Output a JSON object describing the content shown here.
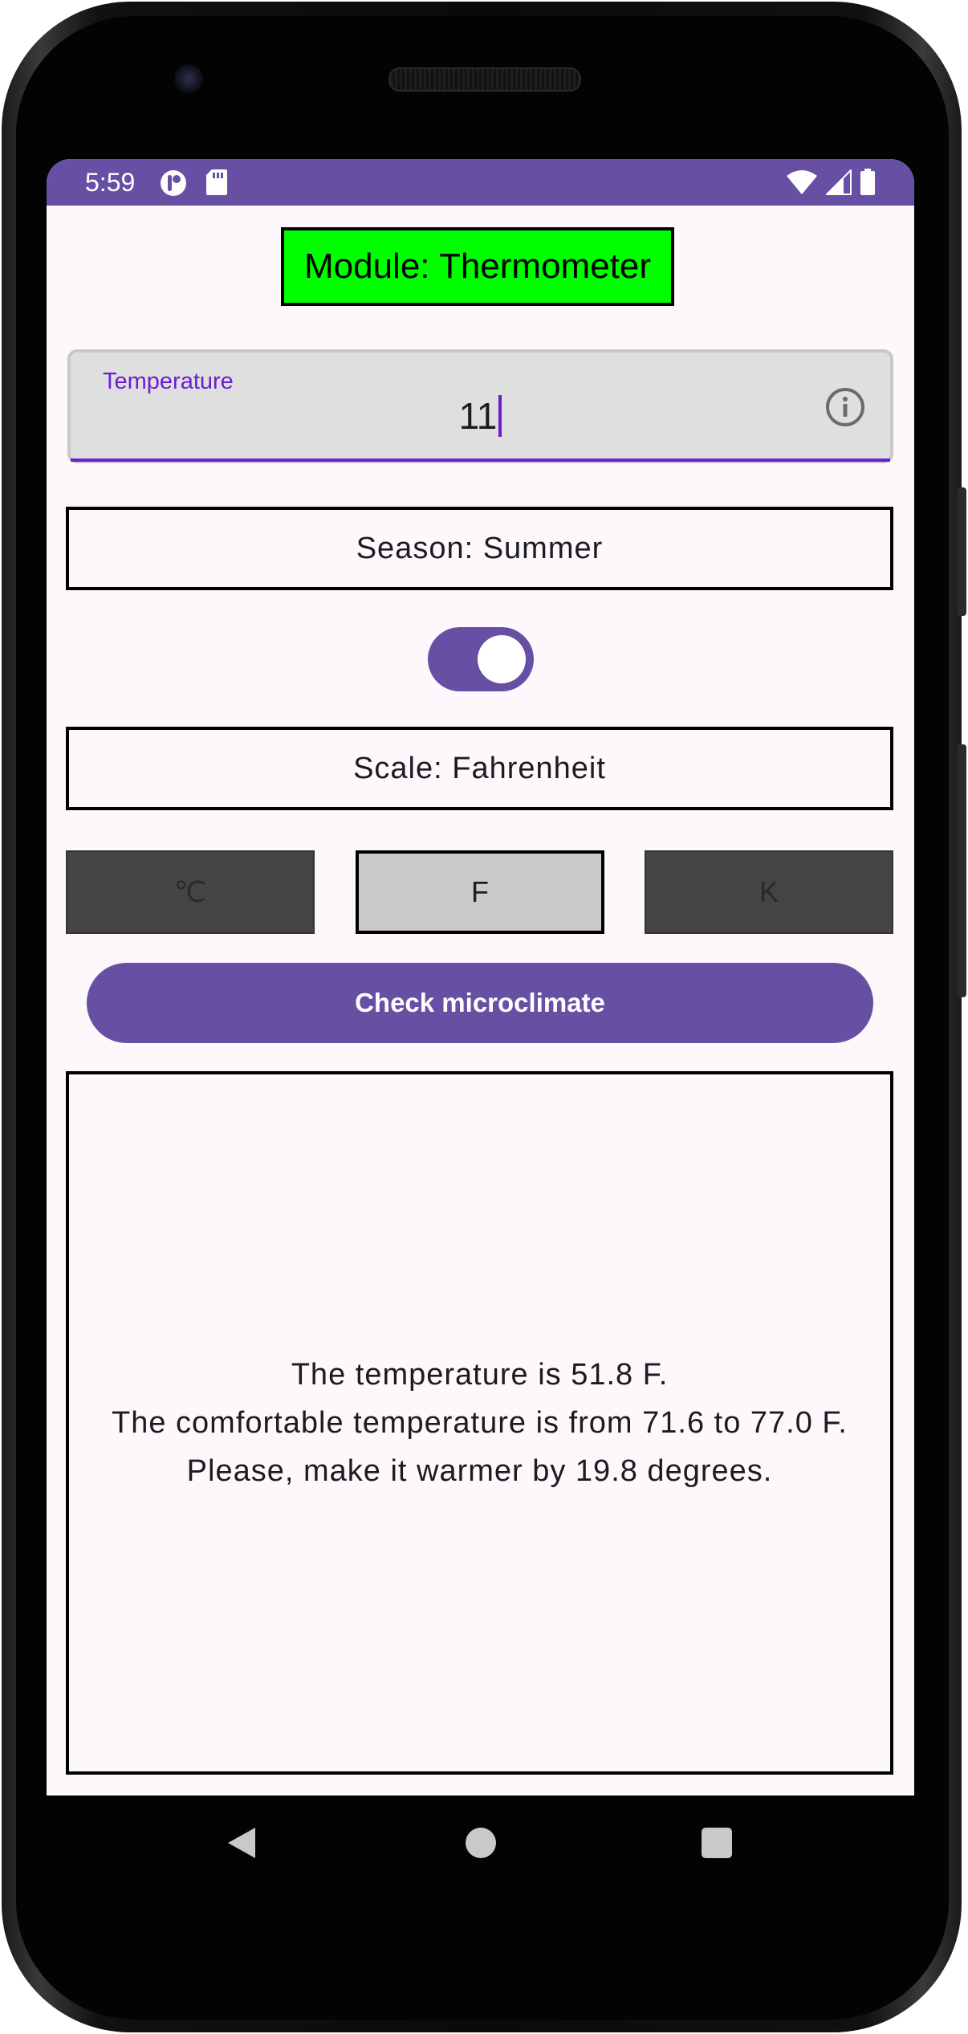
{
  "status_bar": {
    "time": "5:59",
    "left_icons": [
      "podcast-icon",
      "sd-card-icon"
    ],
    "right_icons": [
      "wifi-icon",
      "signal-icon",
      "battery-icon"
    ]
  },
  "module": {
    "label": "Module: Thermometer"
  },
  "temperature_field": {
    "label": "Temperature",
    "value": "11",
    "trailing_icon": "info-icon"
  },
  "season": {
    "label": "Season: Summer"
  },
  "season_switch": {
    "checked": true
  },
  "scale": {
    "label": "Scale: Fahrenheit",
    "buttons": [
      {
        "label": "℃",
        "selected": false
      },
      {
        "label": "F",
        "selected": true
      },
      {
        "label": "K",
        "selected": false
      }
    ]
  },
  "check_button": {
    "label": "Check microclimate"
  },
  "result": {
    "lines": [
      "The temperature is 51.8 F.",
      "The comfortable temperature is from 71.6 to 77.0 F.",
      "Please, make it warmer by 19.8 degrees."
    ]
  },
  "nav_bar": {
    "icons": [
      "back-icon",
      "home-icon",
      "recents-icon"
    ]
  },
  "colors": {
    "primary": "#6750a4",
    "module_bg": "#00ff00",
    "field_accent": "#6a1fd0"
  }
}
